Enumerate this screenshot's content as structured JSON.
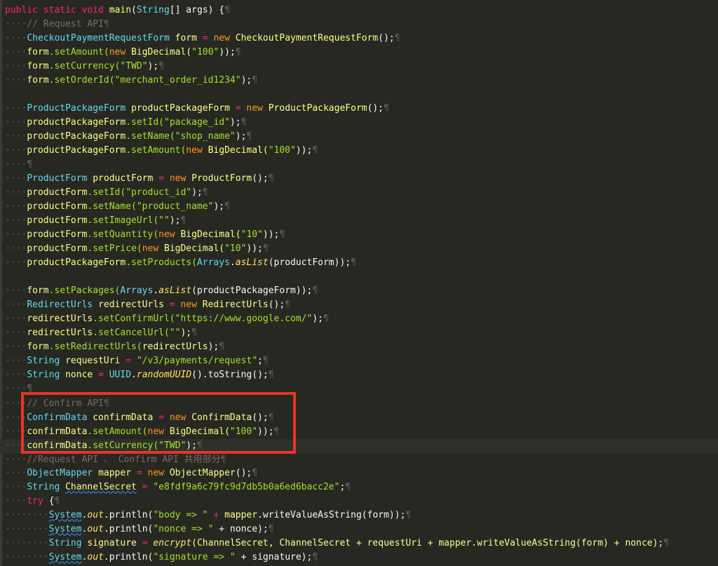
{
  "code": {
    "l1": {
      "a": "public static void ",
      "b": "main",
      "c": "(",
      "d": "String",
      "e": "[] args) {"
    },
    "l2": "// Request API",
    "l3": {
      "a": "CheckoutPaymentRequestForm ",
      "b": "form ",
      "c": "= ",
      "d": "new ",
      "e": "CheckoutPaymentRequestForm",
      "f": "();"
    },
    "l4": {
      "a": "form",
      "b": ".setAmount(",
      "c": "new ",
      "d": "BigDecimal(",
      "e": "\"100\"",
      "f": "));"
    },
    "l5": {
      "a": "form",
      "b": ".setCurrency(",
      "c": "\"TWD\"",
      "d": ");"
    },
    "l6": {
      "a": "form",
      "b": ".setOrderId(",
      "c": "\"merchant_order_id1234\"",
      "d": ");"
    },
    "l8": {
      "a": "ProductPackageForm ",
      "b": "productPackageForm ",
      "c": "= ",
      "d": "new ",
      "e": "ProductPackageForm",
      "f": "();"
    },
    "l9": {
      "a": "productPackageForm",
      "b": ".setId(",
      "c": "\"package_id\"",
      "d": ");"
    },
    "l10": {
      "a": "productPackageForm",
      "b": ".setName(",
      "c": "\"shop_name\"",
      "d": ");"
    },
    "l11": {
      "a": "productPackageForm",
      "b": ".setAmount(",
      "c": "new ",
      "d": "BigDecimal(",
      "e": "\"100\"",
      "f": "));"
    },
    "l13": {
      "a": "ProductForm ",
      "b": "productForm ",
      "c": "= ",
      "d": "new ",
      "e": "ProductForm",
      "f": "();"
    },
    "l14": {
      "a": "productForm",
      "b": ".setId(",
      "c": "\"product_id\"",
      "d": ");"
    },
    "l15": {
      "a": "productForm",
      "b": ".setName(",
      "c": "\"product_name\"",
      "d": ");"
    },
    "l16": {
      "a": "productForm",
      "b": ".setImageUrl(",
      "c": "\"\"",
      "d": ");"
    },
    "l17": {
      "a": "productForm",
      "b": ".setQuantity(",
      "c": "new ",
      "d": "BigDecimal(",
      "e": "\"10\"",
      "f": "));"
    },
    "l18": {
      "a": "productForm",
      "b": ".setPrice(",
      "c": "new ",
      "d": "BigDecimal(",
      "e": "\"10\"",
      "f": "));"
    },
    "l19": {
      "a": "productPackageForm",
      "b": ".setProducts(",
      "c": "Arrays",
      "d": ".",
      "e": "asList",
      "f": "(productForm));"
    },
    "l21": {
      "a": "form",
      "b": ".setPackages(",
      "c": "Arrays",
      "d": ".",
      "e": "asList",
      "f": "(productPackageForm));"
    },
    "l22": {
      "a": "RedirectUrls ",
      "b": "redirectUrls ",
      "c": "= ",
      "d": "new ",
      "e": "RedirectUrls",
      "f": "();"
    },
    "l23": {
      "a": "redirectUrls",
      "b": ".setConfirmUrl(",
      "c": "\"https://www.google.com/\"",
      "d": ");"
    },
    "l24": {
      "a": "redirectUrls",
      "b": ".setCancelUrl(",
      "c": "\"\"",
      "d": ");"
    },
    "l25": {
      "a": "form",
      "b": ".setRedirectUrls(",
      "c": "redirectUrls",
      "d": ");"
    },
    "l26": {
      "a": "String ",
      "b": "requestUri ",
      "c": "= ",
      "d": "\"/v3/payments/request\"",
      "e": ";"
    },
    "l27": {
      "a": "String ",
      "b": "nonce ",
      "c": "= ",
      "d": "UUID",
      "e": ".",
      "f": "randomUUID",
      "g": "().toString();"
    },
    "l29": "// Confirm API",
    "l30": {
      "a": "ConfirmData ",
      "b": "confirmData ",
      "c": "= ",
      "d": "new ",
      "e": "ConfirmData",
      "f": "();"
    },
    "l31": {
      "a": "confirmData",
      "b": ".setAmount(",
      "c": "new ",
      "d": "BigDecimal(",
      "e": "\"100\"",
      "f": "));"
    },
    "l32": {
      "a": "confirmData",
      "b": ".setCurrency(",
      "c": "\"TWD\"",
      "d": ");"
    },
    "l33": "//Request API 、 Confirm API 共用部分",
    "l34": {
      "a": "ObjectMapper ",
      "b": "mapper ",
      "c": "= ",
      "d": "new ",
      "e": "ObjectMapper",
      "f": "();"
    },
    "l35": {
      "a": "String ",
      "b": "ChannelSecret",
      "c": " = ",
      "d": "\"e8fdf9a6c79fc9d7db5b0a6ed6bacc2e\"",
      "e": ";"
    },
    "l36": {
      "a": "try ",
      "b": "{"
    },
    "l37": {
      "a": "System",
      "b": ".",
      "c": "out",
      "d": ".println(",
      "e": "\"body => \"",
      "f": " + ",
      "g": "mapper",
      "h": ".writeValueAsString(form));"
    },
    "l38": {
      "a": "System",
      "b": ".",
      "c": "out",
      "d": ".println(",
      "e": "\"nonce => \"",
      "f": " + nonce);"
    },
    "l39": {
      "a": "String ",
      "b": "signature ",
      "c": "= ",
      "d": "encrypt",
      "e": "(ChannelSecret, ChannelSecret + requestUri + mapper.writeValueAsString(form) + nonce);"
    },
    "l40": {
      "a": "System",
      "b": ".",
      "c": "out",
      "d": ".println(",
      "e": "\"signature => \"",
      "f": " + signature);"
    }
  },
  "symbols": {
    "indent4": "····",
    "indent8": "········",
    "pilcrow": "¶"
  },
  "colors": {
    "background": "#272822",
    "keyword": "#f92672",
    "type": "#66d9ef",
    "variable": "#fcff8c",
    "string": "#a6e22e",
    "comment": "#75715e",
    "highlight_box": "#e5352a"
  }
}
